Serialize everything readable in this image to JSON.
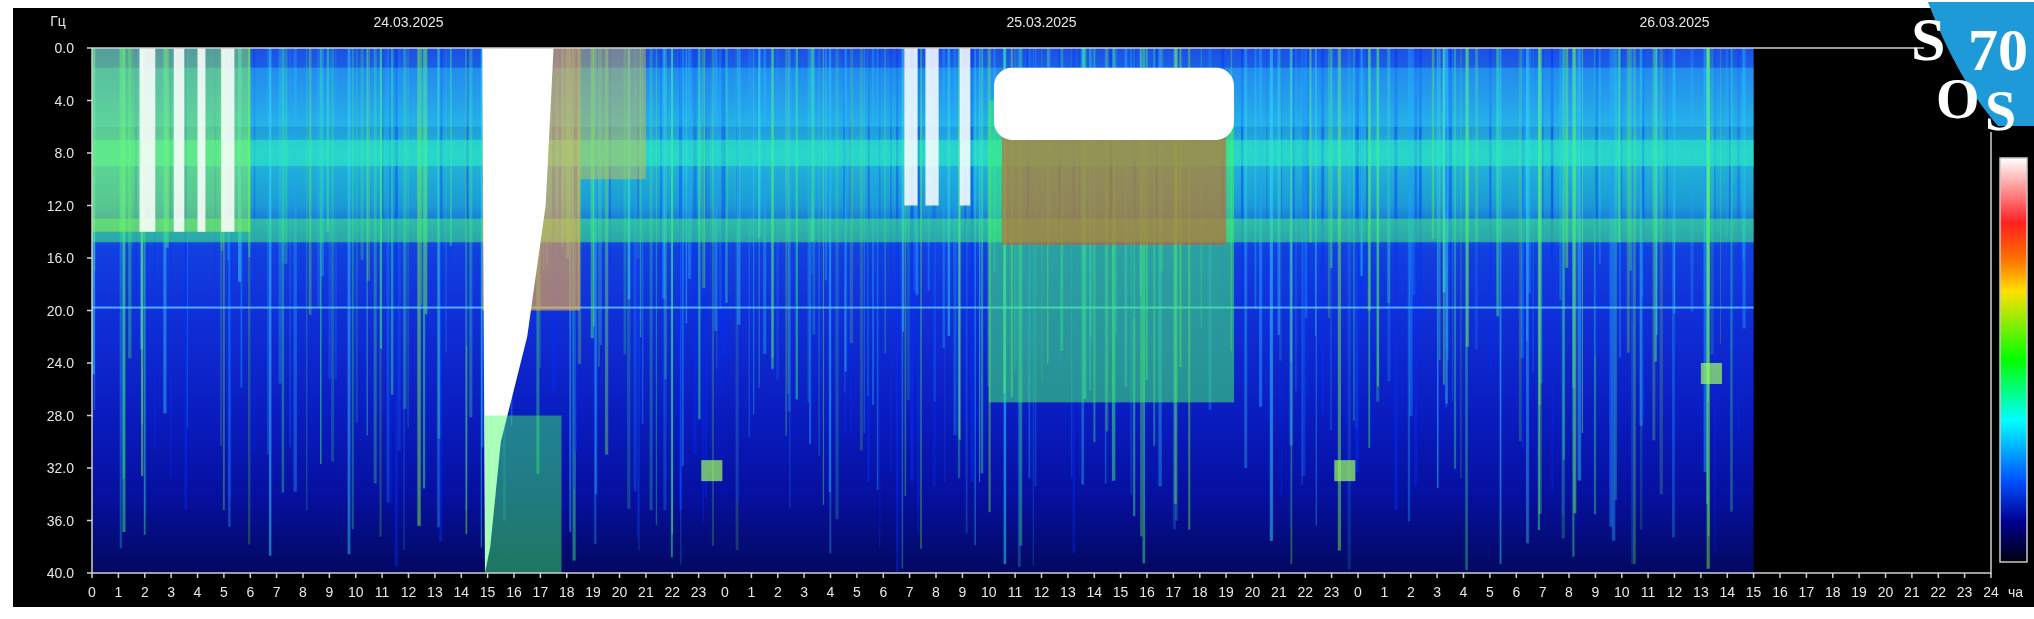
{
  "chart": {
    "y_unit": "Гц",
    "dates": [
      "24.03.2025",
      "25.03.2025",
      "26.03.2025"
    ],
    "y_labels": [
      "0.0",
      "4.0",
      "8.0",
      "12.0",
      "16.0",
      "20.0",
      "24.0",
      "28.0",
      "32.0",
      "36.0",
      "40.0"
    ],
    "x_labels": [
      "0",
      "1",
      "2",
      "3",
      "4",
      "5",
      "6",
      "7",
      "8",
      "9",
      "10",
      "11",
      "12",
      "13",
      "14",
      "15",
      "16",
      "17",
      "18",
      "19",
      "20",
      "21",
      "22",
      "23",
      "0",
      "1",
      "2",
      "3",
      "4",
      "5",
      "6",
      "7",
      "8",
      "9",
      "10",
      "11",
      "12",
      "13",
      "14",
      "15",
      "16",
      "17",
      "18",
      "19",
      "20",
      "21",
      "22",
      "23",
      "0",
      "1",
      "2",
      "3",
      "4",
      "5",
      "6",
      "7",
      "8",
      "9",
      "10",
      "11",
      "12",
      "13",
      "14",
      "15",
      "16",
      "17",
      "18",
      "19",
      "20",
      "21",
      "22",
      "23",
      "24"
    ],
    "x_unit": "ча"
  },
  "logo": {
    "texts": [
      "S",
      "70",
      "O",
      "S"
    ]
  }
}
